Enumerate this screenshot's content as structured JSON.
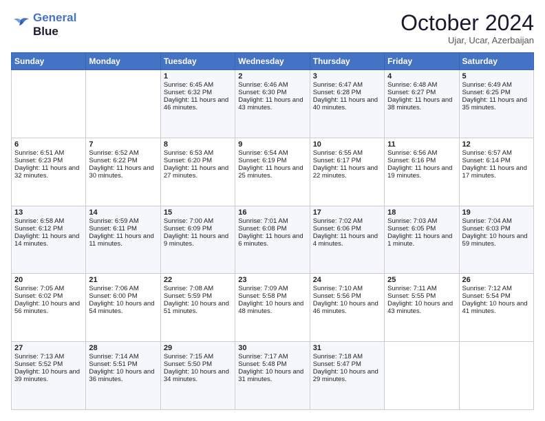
{
  "logo": {
    "line1": "General",
    "line2": "Blue"
  },
  "title": "October 2024",
  "location": "Ujar, Ucar, Azerbaijan",
  "headers": [
    "Sunday",
    "Monday",
    "Tuesday",
    "Wednesday",
    "Thursday",
    "Friday",
    "Saturday"
  ],
  "weeks": [
    [
      {
        "day": "",
        "sunrise": "",
        "sunset": "",
        "daylight": ""
      },
      {
        "day": "",
        "sunrise": "",
        "sunset": "",
        "daylight": ""
      },
      {
        "day": "1",
        "sunrise": "Sunrise: 6:45 AM",
        "sunset": "Sunset: 6:32 PM",
        "daylight": "Daylight: 11 hours and 46 minutes."
      },
      {
        "day": "2",
        "sunrise": "Sunrise: 6:46 AM",
        "sunset": "Sunset: 6:30 PM",
        "daylight": "Daylight: 11 hours and 43 minutes."
      },
      {
        "day": "3",
        "sunrise": "Sunrise: 6:47 AM",
        "sunset": "Sunset: 6:28 PM",
        "daylight": "Daylight: 11 hours and 40 minutes."
      },
      {
        "day": "4",
        "sunrise": "Sunrise: 6:48 AM",
        "sunset": "Sunset: 6:27 PM",
        "daylight": "Daylight: 11 hours and 38 minutes."
      },
      {
        "day": "5",
        "sunrise": "Sunrise: 6:49 AM",
        "sunset": "Sunset: 6:25 PM",
        "daylight": "Daylight: 11 hours and 35 minutes."
      }
    ],
    [
      {
        "day": "6",
        "sunrise": "Sunrise: 6:51 AM",
        "sunset": "Sunset: 6:23 PM",
        "daylight": "Daylight: 11 hours and 32 minutes."
      },
      {
        "day": "7",
        "sunrise": "Sunrise: 6:52 AM",
        "sunset": "Sunset: 6:22 PM",
        "daylight": "Daylight: 11 hours and 30 minutes."
      },
      {
        "day": "8",
        "sunrise": "Sunrise: 6:53 AM",
        "sunset": "Sunset: 6:20 PM",
        "daylight": "Daylight: 11 hours and 27 minutes."
      },
      {
        "day": "9",
        "sunrise": "Sunrise: 6:54 AM",
        "sunset": "Sunset: 6:19 PM",
        "daylight": "Daylight: 11 hours and 25 minutes."
      },
      {
        "day": "10",
        "sunrise": "Sunrise: 6:55 AM",
        "sunset": "Sunset: 6:17 PM",
        "daylight": "Daylight: 11 hours and 22 minutes."
      },
      {
        "day": "11",
        "sunrise": "Sunrise: 6:56 AM",
        "sunset": "Sunset: 6:16 PM",
        "daylight": "Daylight: 11 hours and 19 minutes."
      },
      {
        "day": "12",
        "sunrise": "Sunrise: 6:57 AM",
        "sunset": "Sunset: 6:14 PM",
        "daylight": "Daylight: 11 hours and 17 minutes."
      }
    ],
    [
      {
        "day": "13",
        "sunrise": "Sunrise: 6:58 AM",
        "sunset": "Sunset: 6:12 PM",
        "daylight": "Daylight: 11 hours and 14 minutes."
      },
      {
        "day": "14",
        "sunrise": "Sunrise: 6:59 AM",
        "sunset": "Sunset: 6:11 PM",
        "daylight": "Daylight: 11 hours and 11 minutes."
      },
      {
        "day": "15",
        "sunrise": "Sunrise: 7:00 AM",
        "sunset": "Sunset: 6:09 PM",
        "daylight": "Daylight: 11 hours and 9 minutes."
      },
      {
        "day": "16",
        "sunrise": "Sunrise: 7:01 AM",
        "sunset": "Sunset: 6:08 PM",
        "daylight": "Daylight: 11 hours and 6 minutes."
      },
      {
        "day": "17",
        "sunrise": "Sunrise: 7:02 AM",
        "sunset": "Sunset: 6:06 PM",
        "daylight": "Daylight: 11 hours and 4 minutes."
      },
      {
        "day": "18",
        "sunrise": "Sunrise: 7:03 AM",
        "sunset": "Sunset: 6:05 PM",
        "daylight": "Daylight: 11 hours and 1 minute."
      },
      {
        "day": "19",
        "sunrise": "Sunrise: 7:04 AM",
        "sunset": "Sunset: 6:03 PM",
        "daylight": "Daylight: 10 hours and 59 minutes."
      }
    ],
    [
      {
        "day": "20",
        "sunrise": "Sunrise: 7:05 AM",
        "sunset": "Sunset: 6:02 PM",
        "daylight": "Daylight: 10 hours and 56 minutes."
      },
      {
        "day": "21",
        "sunrise": "Sunrise: 7:06 AM",
        "sunset": "Sunset: 6:00 PM",
        "daylight": "Daylight: 10 hours and 54 minutes."
      },
      {
        "day": "22",
        "sunrise": "Sunrise: 7:08 AM",
        "sunset": "Sunset: 5:59 PM",
        "daylight": "Daylight: 10 hours and 51 minutes."
      },
      {
        "day": "23",
        "sunrise": "Sunrise: 7:09 AM",
        "sunset": "Sunset: 5:58 PM",
        "daylight": "Daylight: 10 hours and 48 minutes."
      },
      {
        "day": "24",
        "sunrise": "Sunrise: 7:10 AM",
        "sunset": "Sunset: 5:56 PM",
        "daylight": "Daylight: 10 hours and 46 minutes."
      },
      {
        "day": "25",
        "sunrise": "Sunrise: 7:11 AM",
        "sunset": "Sunset: 5:55 PM",
        "daylight": "Daylight: 10 hours and 43 minutes."
      },
      {
        "day": "26",
        "sunrise": "Sunrise: 7:12 AM",
        "sunset": "Sunset: 5:54 PM",
        "daylight": "Daylight: 10 hours and 41 minutes."
      }
    ],
    [
      {
        "day": "27",
        "sunrise": "Sunrise: 7:13 AM",
        "sunset": "Sunset: 5:52 PM",
        "daylight": "Daylight: 10 hours and 39 minutes."
      },
      {
        "day": "28",
        "sunrise": "Sunrise: 7:14 AM",
        "sunset": "Sunset: 5:51 PM",
        "daylight": "Daylight: 10 hours and 36 minutes."
      },
      {
        "day": "29",
        "sunrise": "Sunrise: 7:15 AM",
        "sunset": "Sunset: 5:50 PM",
        "daylight": "Daylight: 10 hours and 34 minutes."
      },
      {
        "day": "30",
        "sunrise": "Sunrise: 7:17 AM",
        "sunset": "Sunset: 5:48 PM",
        "daylight": "Daylight: 10 hours and 31 minutes."
      },
      {
        "day": "31",
        "sunrise": "Sunrise: 7:18 AM",
        "sunset": "Sunset: 5:47 PM",
        "daylight": "Daylight: 10 hours and 29 minutes."
      },
      {
        "day": "",
        "sunrise": "",
        "sunset": "",
        "daylight": ""
      },
      {
        "day": "",
        "sunrise": "",
        "sunset": "",
        "daylight": ""
      }
    ]
  ]
}
